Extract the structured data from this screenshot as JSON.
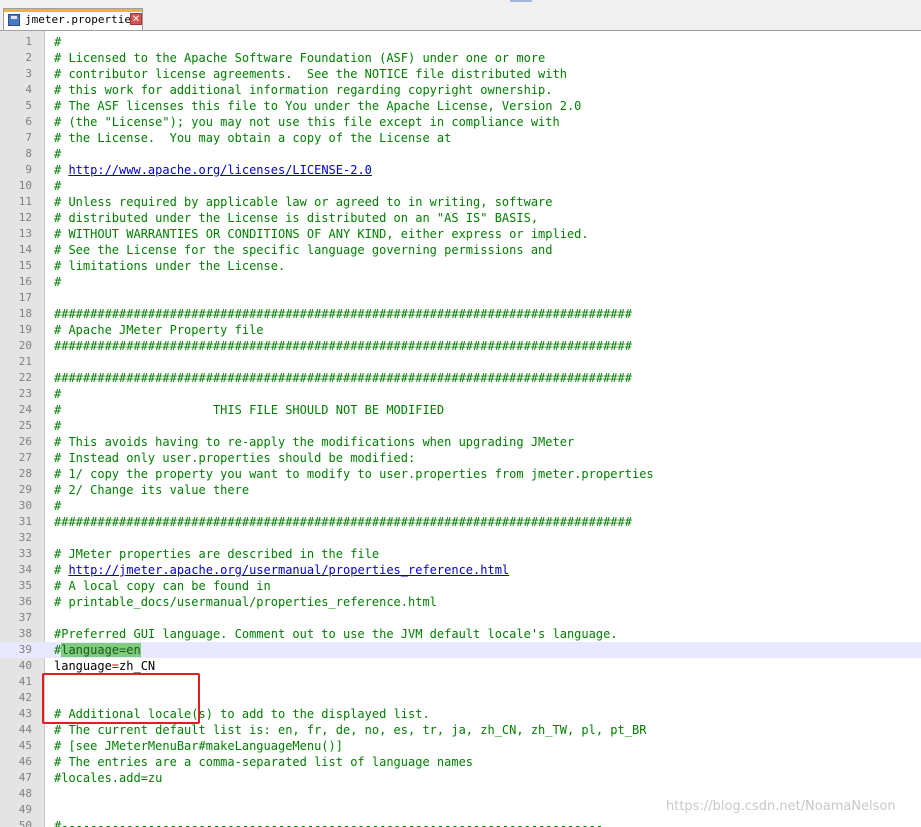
{
  "tab": {
    "label": "jmeter.properties",
    "icon": "properties-file-icon",
    "close_icon": "close-icon"
  },
  "watermark": "https://blog.csdn.net/NoamaNelson",
  "lines": [
    {
      "n": "1",
      "segs": [
        {
          "t": "#",
          "c": "comment"
        }
      ]
    },
    {
      "n": "2",
      "segs": [
        {
          "t": "# Licensed to the Apache Software Foundation (ASF) under one or more",
          "c": "comment"
        }
      ]
    },
    {
      "n": "3",
      "segs": [
        {
          "t": "# contributor license agreements.  See the NOTICE file distributed with",
          "c": "comment"
        }
      ]
    },
    {
      "n": "4",
      "segs": [
        {
          "t": "# this work for additional information regarding copyright ownership.",
          "c": "comment"
        }
      ]
    },
    {
      "n": "5",
      "segs": [
        {
          "t": "# The ASF licenses this file to You under the Apache License, Version 2.0",
          "c": "comment"
        }
      ]
    },
    {
      "n": "6",
      "segs": [
        {
          "t": "# (the \"License\"); you may not use this file except in compliance with",
          "c": "comment"
        }
      ]
    },
    {
      "n": "7",
      "segs": [
        {
          "t": "# the License.  You may obtain a copy of the License at",
          "c": "comment"
        }
      ]
    },
    {
      "n": "8",
      "segs": [
        {
          "t": "#",
          "c": "comment"
        }
      ]
    },
    {
      "n": "9",
      "segs": [
        {
          "t": "# ",
          "c": "comment"
        },
        {
          "t": "http://www.apache.org/licenses/LICENSE-2.0",
          "c": "link"
        }
      ]
    },
    {
      "n": "10",
      "segs": [
        {
          "t": "#",
          "c": "comment"
        }
      ]
    },
    {
      "n": "11",
      "segs": [
        {
          "t": "# Unless required by applicable law or agreed to in writing, software",
          "c": "comment"
        }
      ]
    },
    {
      "n": "12",
      "segs": [
        {
          "t": "# distributed under the License is distributed on an \"AS IS\" BASIS,",
          "c": "comment"
        }
      ]
    },
    {
      "n": "13",
      "segs": [
        {
          "t": "# WITHOUT WARRANTIES OR CONDITIONS OF ANY KIND, either express or implied.",
          "c": "comment"
        }
      ]
    },
    {
      "n": "14",
      "segs": [
        {
          "t": "# See the License for the specific language governing permissions and",
          "c": "comment"
        }
      ]
    },
    {
      "n": "15",
      "segs": [
        {
          "t": "# limitations under the License.",
          "c": "comment"
        }
      ]
    },
    {
      "n": "16",
      "segs": [
        {
          "t": "#",
          "c": "comment"
        }
      ]
    },
    {
      "n": "17",
      "segs": []
    },
    {
      "n": "18",
      "segs": [
        {
          "t": "################################################################################",
          "c": "comment"
        }
      ]
    },
    {
      "n": "19",
      "segs": [
        {
          "t": "# Apache JMeter Property file",
          "c": "comment"
        }
      ]
    },
    {
      "n": "20",
      "segs": [
        {
          "t": "################################################################################",
          "c": "comment"
        }
      ]
    },
    {
      "n": "21",
      "segs": []
    },
    {
      "n": "22",
      "segs": [
        {
          "t": "################################################################################",
          "c": "comment"
        }
      ]
    },
    {
      "n": "23",
      "segs": [
        {
          "t": "#",
          "c": "comment"
        }
      ]
    },
    {
      "n": "24",
      "segs": [
        {
          "t": "#                     THIS FILE SHOULD NOT BE MODIFIED",
          "c": "comment"
        }
      ]
    },
    {
      "n": "25",
      "segs": [
        {
          "t": "#",
          "c": "comment"
        }
      ]
    },
    {
      "n": "26",
      "segs": [
        {
          "t": "# This avoids having to re-apply the modifications when upgrading JMeter",
          "c": "comment"
        }
      ]
    },
    {
      "n": "27",
      "segs": [
        {
          "t": "# Instead only user.properties should be modified:",
          "c": "comment"
        }
      ]
    },
    {
      "n": "28",
      "segs": [
        {
          "t": "# 1/ copy the property you want to modify to user.properties from jmeter.properties",
          "c": "comment"
        }
      ]
    },
    {
      "n": "29",
      "segs": [
        {
          "t": "# 2/ Change its value there",
          "c": "comment"
        }
      ]
    },
    {
      "n": "30",
      "segs": [
        {
          "t": "#",
          "c": "comment"
        }
      ]
    },
    {
      "n": "31",
      "segs": [
        {
          "t": "################################################################################",
          "c": "comment"
        }
      ]
    },
    {
      "n": "32",
      "segs": []
    },
    {
      "n": "33",
      "segs": [
        {
          "t": "# JMeter properties are described in the file",
          "c": "comment"
        }
      ]
    },
    {
      "n": "34",
      "segs": [
        {
          "t": "# ",
          "c": "comment"
        },
        {
          "t": "http://jmeter.apache.org/usermanual/properties_reference.html",
          "c": "link"
        }
      ]
    },
    {
      "n": "35",
      "segs": [
        {
          "t": "# A local copy can be found in",
          "c": "comment"
        }
      ]
    },
    {
      "n": "36",
      "segs": [
        {
          "t": "# printable_docs/usermanual/properties_reference.html",
          "c": "comment"
        }
      ]
    },
    {
      "n": "37",
      "segs": []
    },
    {
      "n": "38",
      "segs": [
        {
          "t": "#Preferred GUI language. Comment out to use the JVM default locale's language.",
          "c": "comment"
        }
      ]
    },
    {
      "n": "39",
      "current": true,
      "segs": [
        {
          "t": "#",
          "c": "comment"
        },
        {
          "t": "language=en",
          "c": "hl"
        }
      ]
    },
    {
      "n": "40",
      "segs": [
        {
          "t": "language",
          "c": "key"
        },
        {
          "t": "=",
          "c": "op"
        },
        {
          "t": "zh_CN",
          "c": "val"
        }
      ]
    },
    {
      "n": "41",
      "segs": []
    },
    {
      "n": "42",
      "segs": []
    },
    {
      "n": "43",
      "segs": [
        {
          "t": "# Additional locale(s) to add to the displayed list.",
          "c": "comment"
        }
      ]
    },
    {
      "n": "44",
      "segs": [
        {
          "t": "# The current default list is: en, fr, de, no, es, tr, ja, zh_CN, zh_TW, pl, pt_BR",
          "c": "comment"
        }
      ]
    },
    {
      "n": "45",
      "segs": [
        {
          "t": "# [see JMeterMenuBar#makeLanguageMenu()]",
          "c": "comment"
        }
      ]
    },
    {
      "n": "46",
      "segs": [
        {
          "t": "# The entries are a comma-separated list of language names",
          "c": "comment"
        }
      ]
    },
    {
      "n": "47",
      "segs": [
        {
          "t": "#locales.add=zu",
          "c": "comment"
        }
      ]
    },
    {
      "n": "48",
      "segs": []
    },
    {
      "n": "49",
      "segs": []
    },
    {
      "n": "50",
      "segs": [
        {
          "t": "#---------------------------------------------------------------------------",
          "c": "comment"
        }
      ]
    }
  ]
}
